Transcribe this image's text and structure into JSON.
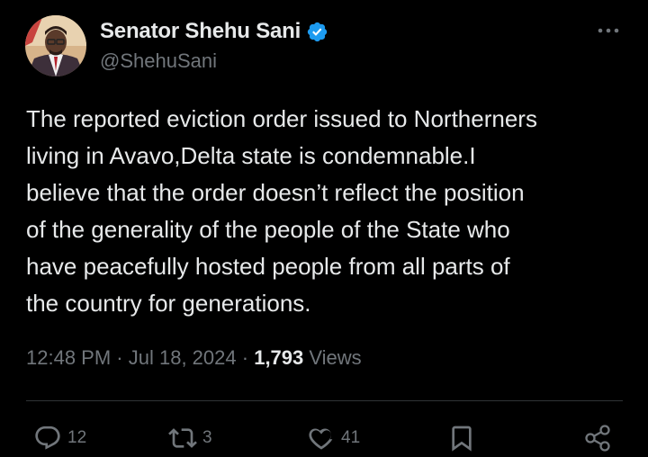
{
  "author": {
    "display_name": "Senator Shehu Sani",
    "handle": "@ShehuSani",
    "verified_icon": "verified-badge-icon",
    "avatar_icon": "profile-photo"
  },
  "more_icon": "more-options-icon",
  "tweet": {
    "lines": [
      "The reported eviction order issued to Northerners",
      "living in Avavo,Delta state is condemnable.I",
      "believe that the order doesn’t reflect the position",
      "of the generality of the people of the State who",
      "have peacefully hosted people from all parts of",
      "the country for generations."
    ]
  },
  "meta": {
    "time": "12:48 PM",
    "separator": "·",
    "date": "Jul 18, 2024",
    "views_count": "1,793",
    "views_label": "Views"
  },
  "actions": {
    "reply": {
      "icon": "reply-icon",
      "count": "12"
    },
    "repost": {
      "icon": "repost-icon",
      "count": "3"
    },
    "like": {
      "icon": "heart-icon",
      "count": "41"
    },
    "bookmark": {
      "icon": "bookmark-icon"
    },
    "share": {
      "icon": "share-icon"
    }
  },
  "colors": {
    "background": "#000000",
    "primary_text": "#e7e9ea",
    "secondary_text": "#71767b",
    "verified_blue": "#1d9bf0",
    "divider": "#2f3336"
  }
}
